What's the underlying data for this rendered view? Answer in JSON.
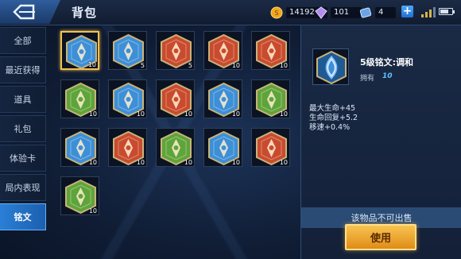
{
  "header": {
    "title": "背包",
    "gold": "14192",
    "diamond": "101",
    "coupon": "4",
    "plus_label": "+"
  },
  "sidebar": {
    "items": [
      {
        "label": "全部"
      },
      {
        "label": "最近获得"
      },
      {
        "label": "道具"
      },
      {
        "label": "礼包"
      },
      {
        "label": "体验卡"
      },
      {
        "label": "局内表现"
      },
      {
        "label": "铭文"
      }
    ],
    "active_index": 6
  },
  "inventory": {
    "items": [
      {
        "color": "blue",
        "count": "10"
      },
      {
        "color": "blue",
        "count": "5"
      },
      {
        "color": "red",
        "count": "5"
      },
      {
        "color": "red",
        "count": "10"
      },
      {
        "color": "red",
        "count": "10"
      },
      {
        "color": "green",
        "count": "10"
      },
      {
        "color": "blue",
        "count": "10"
      },
      {
        "color": "red",
        "count": "10"
      },
      {
        "color": "blue",
        "count": "10"
      },
      {
        "color": "green",
        "count": "10"
      },
      {
        "color": "blue",
        "count": "10"
      },
      {
        "color": "red",
        "count": "10"
      },
      {
        "color": "green",
        "count": "10"
      },
      {
        "color": "blue",
        "count": "10"
      },
      {
        "color": "red",
        "count": "10"
      },
      {
        "color": "green",
        "count": "10"
      }
    ],
    "selected_index": 0
  },
  "detail": {
    "name": "5级铭文:调和",
    "own_label": "拥有",
    "own_qty": "10",
    "stats": [
      "最大生命+45",
      "生命回复+5.2",
      "移速+0.4%"
    ],
    "not_sellable": "该物品不可出售",
    "use_label": "使用"
  },
  "colors": {
    "blue": "#3d8fd6",
    "red": "#c94b2e",
    "green": "#5fa43a",
    "accent": "#2a7fd6",
    "gold": "#f2c14e"
  }
}
